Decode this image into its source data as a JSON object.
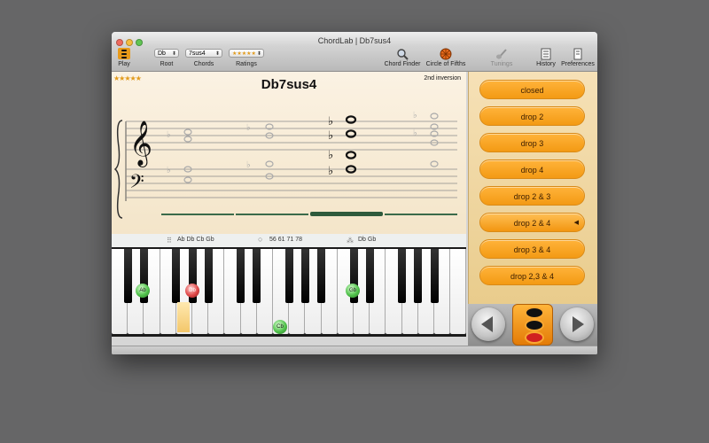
{
  "window": {
    "title": "ChordLab | Db7sus4"
  },
  "toolbar": {
    "play_label": "Play",
    "root_label": "Root",
    "root_value": "Db",
    "chords_label": "Chords",
    "chords_value": "7sus4",
    "ratings_label": "Ratings",
    "ratings_value": "★★★★★",
    "chord_finder_label": "Chord Finder",
    "circle_label": "Circle of Fifths",
    "tunings_label": "Tunings",
    "history_label": "History",
    "preferences_label": "Preferences"
  },
  "main": {
    "rating": "★★★★★",
    "chord_name": "Db7sus4",
    "inversion": "2nd inversion",
    "notes_names": "Ab  Db  Cb  Gb",
    "midi_numbers": "56 61 71 78",
    "pedal_notes": "Db  Gb"
  },
  "keyboard": {
    "markers": [
      {
        "label": "Ab",
        "color": "green"
      },
      {
        "label": "Db",
        "color": "red"
      },
      {
        "label": "Gb",
        "color": "green"
      },
      {
        "label": "Cb",
        "color": "green"
      }
    ]
  },
  "voicings": {
    "items": [
      "closed",
      "drop 2",
      "drop 3",
      "drop 4",
      "drop 2 & 3",
      "drop 2 & 4",
      "drop 3 & 4",
      "drop 2,3 & 4"
    ],
    "selected": "drop 2 & 4"
  },
  "colors": {
    "accent": "#f39a14",
    "panel": "#f3e4c7",
    "marker_green": "#4fc04a",
    "marker_red": "#e04848"
  }
}
